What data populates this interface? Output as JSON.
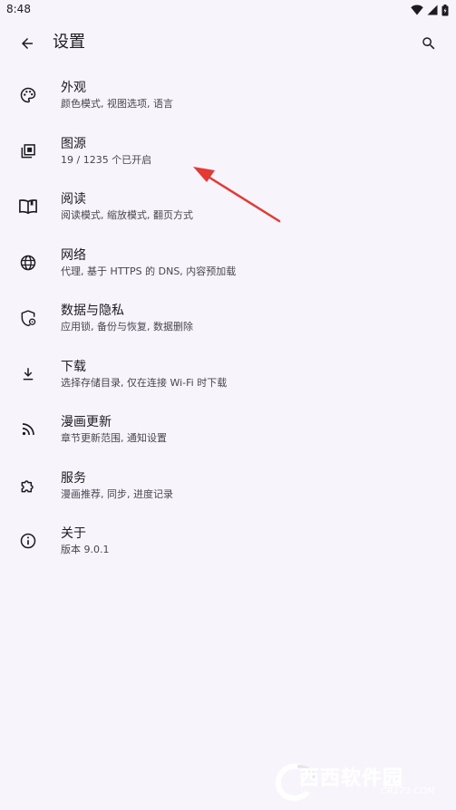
{
  "status_bar": {
    "time": "8:48"
  },
  "app_bar": {
    "title": "设置",
    "back_icon": "arrow-left-icon",
    "search_icon": "search-icon"
  },
  "settings": [
    {
      "icon": "palette-icon",
      "title": "外观",
      "subtitle": "颜色模式, 视图选项, 语言"
    },
    {
      "icon": "library-icon",
      "title": "图源",
      "subtitle": "19 / 1235 个已开启"
    },
    {
      "icon": "book-open-icon",
      "title": "阅读",
      "subtitle": "阅读模式, 缩放模式, 翻页方式"
    },
    {
      "icon": "globe-icon",
      "title": "网络",
      "subtitle": "代理, 基于 HTTPS 的 DNS, 内容预加载"
    },
    {
      "icon": "shield-lock-icon",
      "title": "数据与隐私",
      "subtitle": "应用锁, 备份与恢复, 数据删除"
    },
    {
      "icon": "download-icon",
      "title": "下载",
      "subtitle": "选择存储目录, 仅在连接 Wi-Fi 时下载"
    },
    {
      "icon": "rss-icon",
      "title": "漫画更新",
      "subtitle": "章节更新范围, 通知设置"
    },
    {
      "icon": "puzzle-icon",
      "title": "服务",
      "subtitle": "漫画推荐, 同步, 进度记录"
    },
    {
      "icon": "info-icon",
      "title": "关于",
      "subtitle": "版本 9.0.1"
    }
  ],
  "watermark": {
    "text": "西西软件园",
    "sub": "CR173.COM"
  },
  "colors": {
    "background": "#f7f4fc",
    "text": "#1c1b1f",
    "subtext": "#49454f",
    "annotation_arrow": "#e53935"
  }
}
